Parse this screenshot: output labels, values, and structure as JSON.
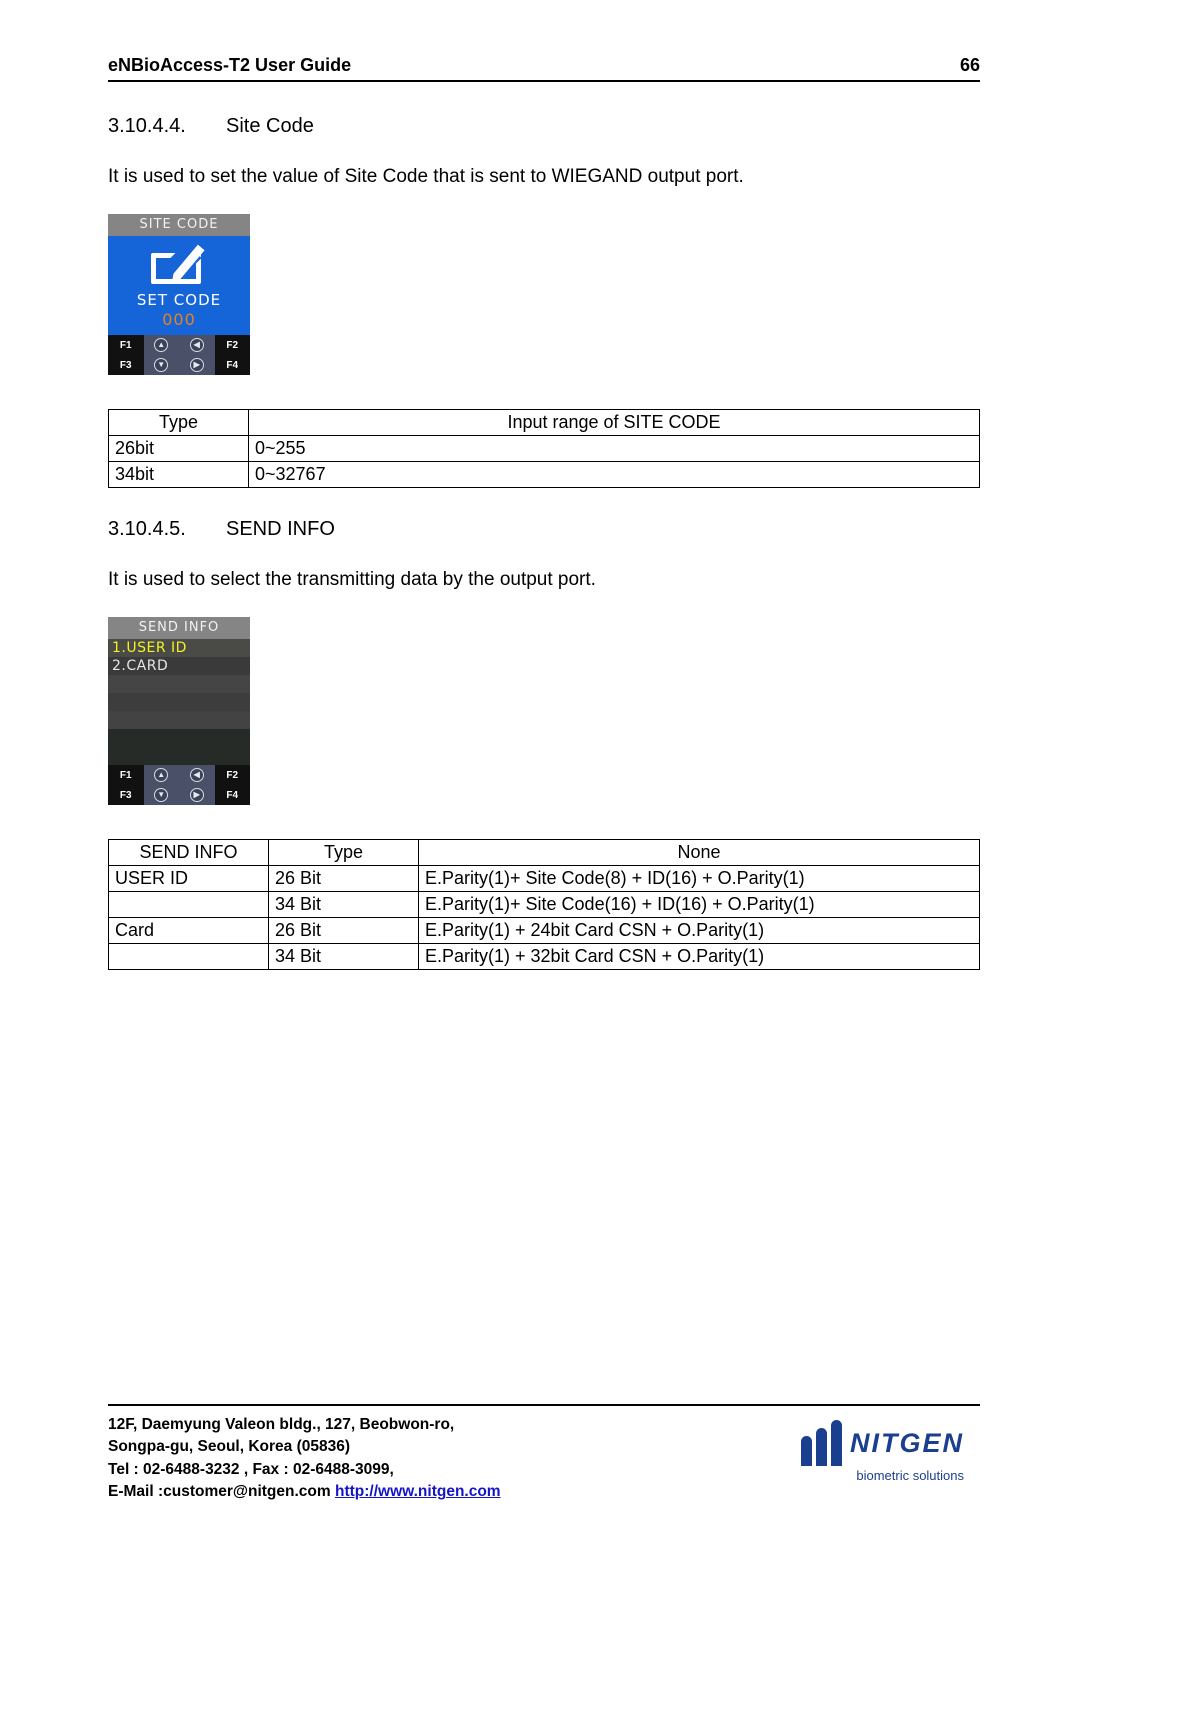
{
  "header": {
    "title": "eNBioAccess-T2 User Guide",
    "page_number": "66"
  },
  "sections": [
    {
      "number": "3.10.4.4.",
      "title": "Site Code",
      "paragraph": "It is used to set the value of Site Code that is sent to WIEGAND output port."
    },
    {
      "number": "3.10.4.5.",
      "title": "SEND INFO",
      "paragraph": "It is used to select the transmitting data by the output port."
    }
  ],
  "site_code_device": {
    "title_bar": "SITE CODE",
    "icon": "edit-pencil-icon",
    "label": "SET CODE",
    "value": "000",
    "accent_color": "#e8821e",
    "screen_color": "#1565d8",
    "keys": [
      [
        "F1",
        "up-arrow-icon",
        "left-arrow-icon",
        "F2"
      ],
      [
        "F3",
        "down-arrow-icon",
        "right-arrow-icon",
        "F4"
      ]
    ]
  },
  "send_info_device": {
    "title_bar": "SEND INFO",
    "items": [
      {
        "label": "1.USER ID",
        "selected": true
      },
      {
        "label": "2.CARD",
        "selected": false
      }
    ],
    "selected_color": "#f3f323",
    "keys": [
      [
        "F1",
        "up-arrow-icon",
        "left-arrow-icon",
        "F2"
      ],
      [
        "F3",
        "down-arrow-icon",
        "right-arrow-icon",
        "F4"
      ]
    ]
  },
  "site_code_table": {
    "headers": [
      "Type",
      "Input range of SITE CODE"
    ],
    "rows": [
      [
        "26bit",
        "0~255"
      ],
      [
        "34bit",
        "0~32767"
      ]
    ]
  },
  "send_info_table": {
    "headers": [
      "SEND INFO",
      "Type",
      "None"
    ],
    "rows": [
      {
        "info": "USER ID",
        "type": "26 Bit",
        "format": "E.Parity(1)+ Site Code(8) + ID(16) + O.Parity(1)"
      },
      {
        "info": "",
        "type": "34 Bit",
        "format": "E.Parity(1)+ Site Code(16) + ID(16) + O.Parity(1)"
      },
      {
        "info": "Card",
        "type": "26 Bit",
        "format": "E.Parity(1) + 24bit Card CSN + O.Parity(1)"
      },
      {
        "info": "",
        "type": "34 Bit",
        "format": "E.Parity(1) + 32bit Card CSN + O.Parity(1)"
      }
    ]
  },
  "footer": {
    "address_line1": "12F, Daemyung Valeon bldg., 127, Beobwon-ro,",
    "address_line2": "Songpa-gu, Seoul, Korea (05836)",
    "address_line3": "Tel : 02-6488-3232 , Fax : 02-6488-3099,",
    "email_label": "E-Mail :customer@nitgen.com",
    "website": "http://www.nitgen.com",
    "logo_text": "NITGEN",
    "logo_tagline": "biometric solutions",
    "logo_color": "#1b3f8f"
  }
}
